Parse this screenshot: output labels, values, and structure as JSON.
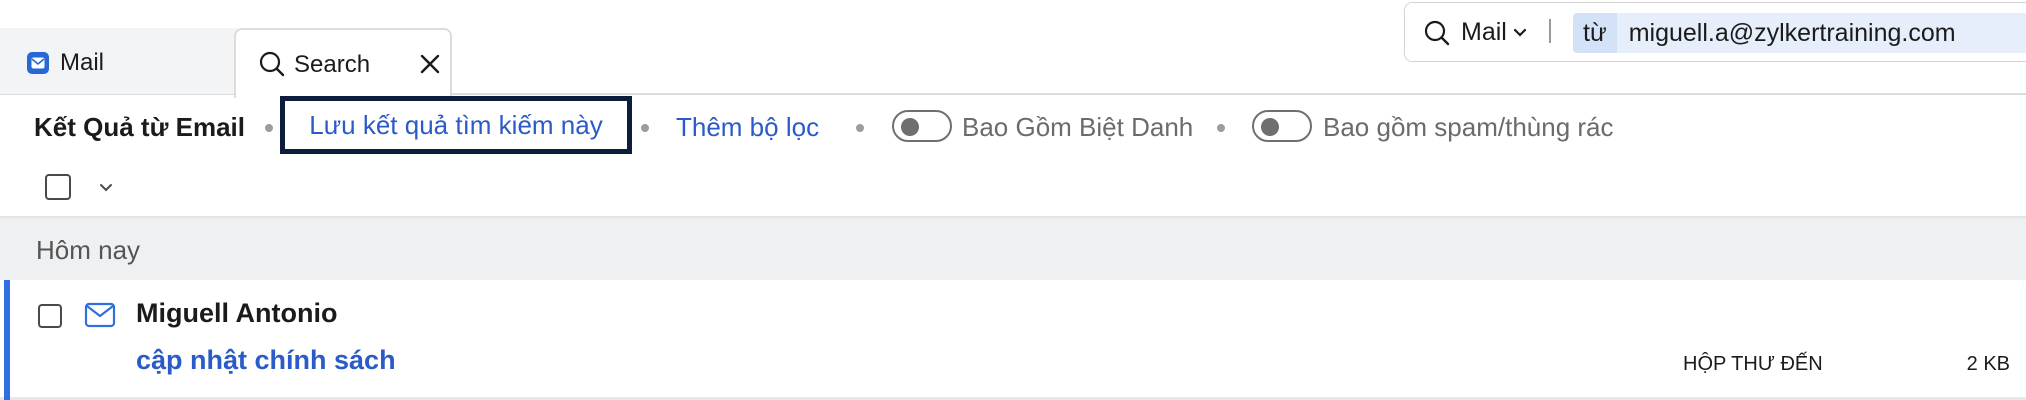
{
  "tabs": {
    "mail_label": "Mail",
    "search_label": "Search"
  },
  "search": {
    "scope_label": "Mail",
    "chip_key": "từ",
    "chip_value": "miguell.a@zylkertraining.com"
  },
  "filter_bar": {
    "title": "Kết Quả từ Email",
    "save_search_link": "Lưu kết quả tìm kiếm này",
    "add_filter_link": "Thêm bộ lọc",
    "include_alias_label": "Bao Gồm Biệt Danh",
    "include_alias_on": false,
    "include_spam_label": "Bao gồm spam/thùng rác",
    "include_spam_on": false
  },
  "group": {
    "label": "Hôm nay"
  },
  "messages": [
    {
      "sender": "Miguell Antonio",
      "subject": "cập nhật chính sách",
      "folder": "HỘP THƯ ĐẾN",
      "size": "2 KB"
    }
  ],
  "colors": {
    "accent": "#2f6fe0",
    "link": "#2a5bc8",
    "focus_border": "#0f1d3d",
    "group_bg": "#eff0f1"
  }
}
